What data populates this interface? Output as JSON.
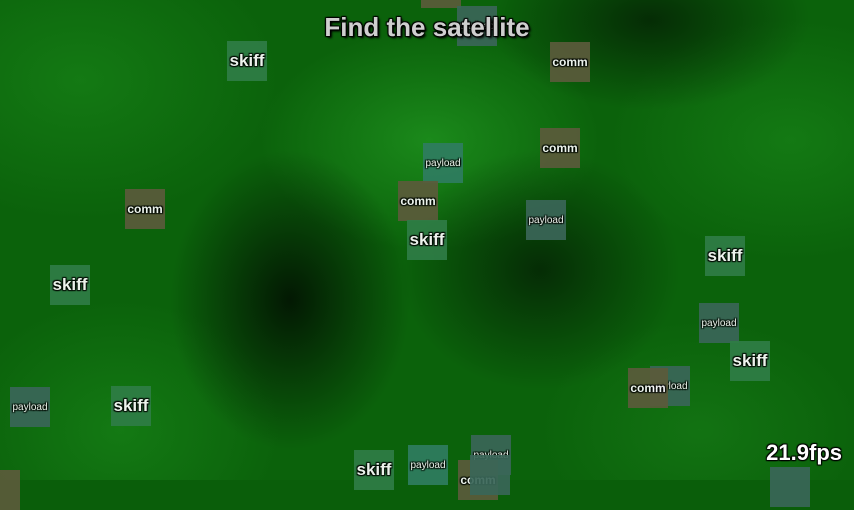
{
  "title": "Find the satellite",
  "fps": "21.9fps",
  "colors": {
    "skiff": "#2f7d46",
    "comm": "#5b5b3b",
    "payload": "#3a6658",
    "payload_alt": "#2f7d60"
  },
  "sprites": [
    {
      "kind": "comm",
      "label": ""
    },
    {
      "kind": "skiff",
      "label": "skiff"
    },
    {
      "kind": "comm",
      "label": "comm"
    },
    {
      "kind": "payload",
      "label": "payload"
    },
    {
      "kind": "comm",
      "label": "comm"
    },
    {
      "kind": "comm",
      "label": "comm"
    },
    {
      "kind": "comm",
      "label": "comm"
    },
    {
      "kind": "payload",
      "label": "payload"
    },
    {
      "kind": "skiff",
      "label": "skiff"
    },
    {
      "kind": "skiff",
      "label": "skiff"
    },
    {
      "kind": "skiff",
      "label": "skiff"
    },
    {
      "kind": "payload",
      "label": "payload"
    },
    {
      "kind": "skiff",
      "label": "skiff"
    },
    {
      "kind": "payload",
      "label": "payload"
    },
    {
      "kind": "comm",
      "label": "comm"
    },
    {
      "kind": "payload",
      "label": "payload"
    },
    {
      "kind": "skiff",
      "label": "skiff"
    },
    {
      "kind": "payload",
      "label": "payload"
    },
    {
      "kind": "skiff",
      "label": "skiff"
    },
    {
      "kind": "payload",
      "label": "payload"
    },
    {
      "kind": "payload",
      "label": "payload"
    },
    {
      "kind": "comm",
      "label": "comm"
    },
    {
      "kind": "comm",
      "label": ""
    },
    {
      "kind": "payload",
      "label": ""
    },
    {
      "kind": "payload",
      "label": ""
    }
  ]
}
